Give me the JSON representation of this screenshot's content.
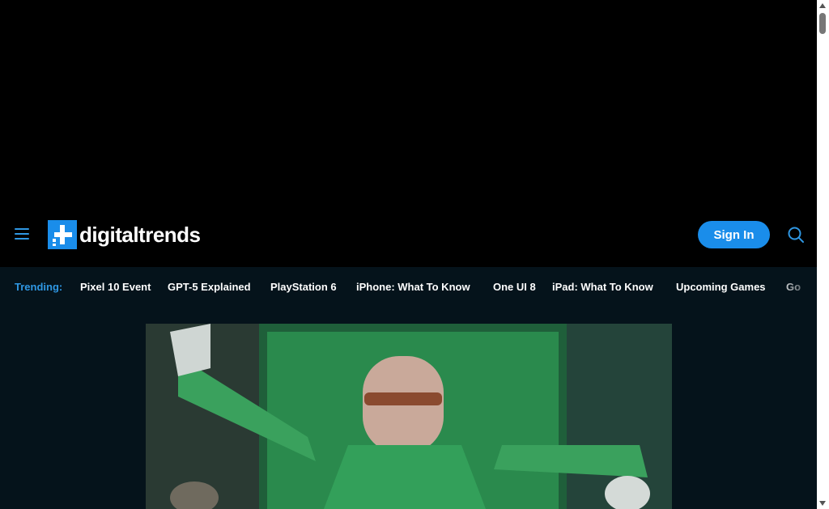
{
  "header": {
    "logo_text": "digitaltrends",
    "signin_label": "Sign In"
  },
  "trending": {
    "label": "Trending:",
    "items": [
      "Pixel 10 Event",
      "GPT-5 Explained",
      "PlayStation 6",
      "iPhone: What To Know",
      "One UI 8",
      "iPad: What To Know",
      "Upcoming Games",
      "Go"
    ]
  },
  "icons": {
    "menu": "hamburger-menu-icon",
    "search": "search-icon",
    "logo": "digitaltrends-logo-icon"
  },
  "colors": {
    "accent": "#1a8dea",
    "trending_label": "#2f97e3",
    "background": "#05131b"
  }
}
